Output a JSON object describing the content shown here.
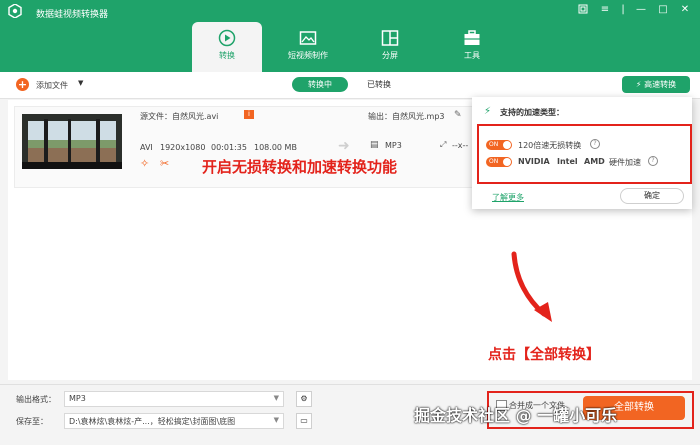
{
  "app": {
    "title": "数据蛙视频转换器"
  },
  "nav": [
    {
      "label": "转换"
    },
    {
      "label": "短视频制作"
    },
    {
      "label": "分屏"
    },
    {
      "label": "工具"
    }
  ],
  "toolbar": {
    "add_file": "添加文件",
    "tab_converting": "转换中",
    "tab_converted": "已转换",
    "fast_convert": "高速转换"
  },
  "file": {
    "source": "源文件：自然风光.avi",
    "output": "输出：自然风光.mp3",
    "format_in": "AVI",
    "resolution": "1920x1080",
    "duration": "00:01:35",
    "size": "108.00 MB",
    "format_out": "MP3",
    "out_res": "--x--"
  },
  "annotation_top": "开启无损转换和加速转换功能",
  "annotation_bottom": "点击【全部转换】",
  "popup": {
    "title": "支持的加速类型：",
    "option1": "120倍速无损转换",
    "option2_nvidia": "NVIDIA",
    "option2_intel": "Intel",
    "option2_amd": "AMD",
    "option2_suffix": "硬件加速",
    "toggle_on": "ON",
    "learn_more": "了解更多",
    "confirm": "确定"
  },
  "bottom": {
    "format_label": "输出格式：",
    "format_value": "MP3",
    "save_label": "保存至：",
    "save_value": "D:\\袁林炫\\袁林炫-产...，轻松搞定\\封面图\\底图",
    "merge_label": "合并成一个文件",
    "convert_all": "全部转换"
  },
  "watermark": "掘金技术社区 @ 一罐小可乐"
}
